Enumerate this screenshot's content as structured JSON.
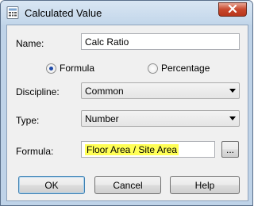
{
  "window": {
    "title": "Calculated Value"
  },
  "icons": {
    "app": "calculator-icon",
    "close": "close-icon",
    "browse": "ellipsis-icon"
  },
  "name_field": {
    "label": "Name:",
    "value": "Calc Ratio"
  },
  "mode": {
    "options": [
      {
        "label": "Formula",
        "selected": true
      },
      {
        "label": "Percentage",
        "selected": false
      }
    ]
  },
  "discipline": {
    "label": "Discipline:",
    "value": "Common"
  },
  "type": {
    "label": "Type:",
    "value": "Number"
  },
  "formula": {
    "label": "Formula:",
    "value": "Floor Area / Site Area",
    "browse_label": "..."
  },
  "buttons": {
    "ok": "OK",
    "cancel": "Cancel",
    "help": "Help"
  },
  "colors": {
    "highlight": "#ffff55",
    "title_bar": "#c2d6ea",
    "close_button": "#c8472c"
  }
}
